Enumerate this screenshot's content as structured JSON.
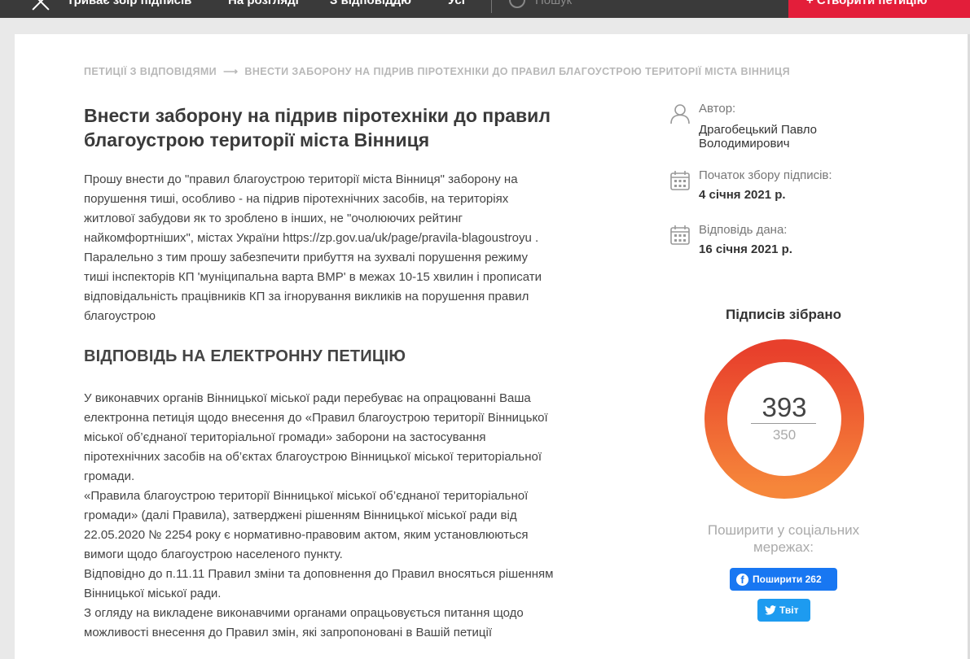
{
  "nav": {
    "items": [
      "Триває збір підписів",
      "На розгляді",
      "З відповіддю",
      "Усі"
    ],
    "search_placeholder": "Пошук",
    "create_label": "+ Створити петицію"
  },
  "breadcrumb": {
    "parent": "ПЕТИЦІЇ З ВІДПОВІДЯМИ",
    "separator": "⟶",
    "current": "ВНЕСТИ ЗАБОРОНУ НА ПІДРИВ ПІРОТЕХНІКИ ДО ПРАВИЛ БЛАГОУСТРОЮ ТЕРИТОРІЇ МІСТА ВІННИЦЯ"
  },
  "petition": {
    "title": "Внести заборону на підрив піротехніки до правил благоустрою території міста Вінниця",
    "body_lines": [
      "Прошу внести до \"правил благоустрою території міста Вінниця\" заборону на",
      "порушення тиші, особливо - на підрив піротехнічних засобів, на територіях",
      "житлової забудови як то зроблено в інших, не \"очолюючих рейтинг",
      "найкомфортніших\", містах України https://zp.gov.ua/uk/page/pravila-blagoustroyu .",
      "Паралельно з тим прошу забезпечити прибуття на зухвалі порушення режиму",
      "тиші інспекторів КП 'муніципальна варта ВМР' в межах 10-15 хвилин і прописати",
      "відповідальність працівників КП за ігнорування викликів на порушення правил",
      "благоустрою"
    ]
  },
  "answer": {
    "heading": "ВІДПОВІДЬ НА ЕЛЕКТРОННУ ПЕТИЦІЮ",
    "lines": [
      "У виконавчих органів Вінницької міської ради перебуває на опрацюванні Ваша",
      "електронна петиція щодо внесення до «Правил благоустрою території Вінницької",
      "міської об’єднаної територіальної громади» заборони на застосування",
      "піротехнічних засобів на об’єктах благоустрою Вінницької міської територіальної",
      "громади.",
      "«Правила благоустрою території Вінницької міської об’єднаної територіальної",
      "громади» (далі Правила), затверджені рішенням Вінницької міської ради від",
      "22.05.2020 № 2254 року є нормативно-правовим актом, яким установлюються",
      "вимоги щодо благоустрою населеного пункту.",
      "Відповідно до п.11.11 Правил зміни та доповнення до Правил вносяться рішенням",
      "Вінницької міської ради.",
      "З огляду на викладене виконавчими органами опрацьовується питання щодо",
      "можливості внесення до Правил змін, які запропоновані в Вашій петиції"
    ]
  },
  "sidebar": {
    "author_label": "Автор:",
    "author_name_line1": "Драгобецький Павло",
    "author_name_line2": "Володимирович",
    "start_label": "Початок збору підписів:",
    "start_date": "4 січня 2021 р.",
    "answer_label": "Відповідь дана:",
    "answer_date": "16 січня 2021 р.",
    "signatures_title": "Підписів зібрано",
    "signatures_count": "393",
    "signatures_target": "350",
    "signatures_progress_fraction": 1.0,
    "donut_gradient": [
      "#f6863a",
      "#e8402c"
    ],
    "share_title_line1": "Поширити у соціальних",
    "share_title_line2": "мережах:",
    "facebook_label": "Поширити 262",
    "twitter_label": "Твіт"
  }
}
